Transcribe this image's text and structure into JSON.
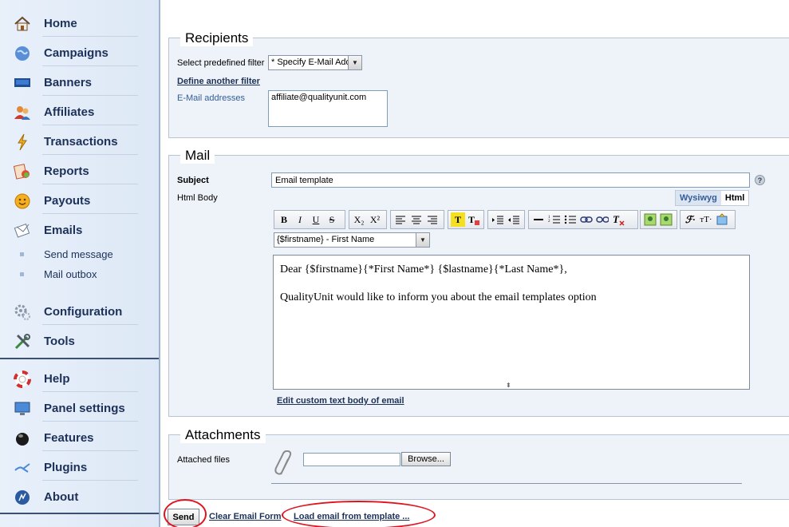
{
  "sidebar": {
    "items": [
      {
        "label": "Home",
        "icon": "home-icon"
      },
      {
        "label": "Campaigns",
        "icon": "globe-icon"
      },
      {
        "label": "Banners",
        "icon": "monitor-icon"
      },
      {
        "label": "Affiliates",
        "icon": "users-icon"
      },
      {
        "label": "Transactions",
        "icon": "lightning-icon"
      },
      {
        "label": "Reports",
        "icon": "report-icon"
      },
      {
        "label": "Payouts",
        "icon": "coin-icon"
      },
      {
        "label": "Emails",
        "icon": "envelope-icon"
      }
    ],
    "sub_items": [
      {
        "label": "Send message"
      },
      {
        "label": "Mail outbox"
      }
    ],
    "items2": [
      {
        "label": "Configuration",
        "icon": "gears-icon"
      },
      {
        "label": "Tools",
        "icon": "tools-icon"
      }
    ],
    "items3": [
      {
        "label": "Help",
        "icon": "lifebuoy-icon"
      },
      {
        "label": "Panel settings",
        "icon": "monitor-settings-icon"
      },
      {
        "label": "Features",
        "icon": "ball-icon"
      },
      {
        "label": "Plugins",
        "icon": "plug-icon"
      },
      {
        "label": "About",
        "icon": "about-icon"
      }
    ]
  },
  "recipients": {
    "legend": "Recipients",
    "filter_label": "Select predefined filter",
    "filter_value": "* Specify E-Mail Add",
    "define_filter_link": "Define another filter",
    "emails_label": "E-Mail addresses",
    "emails_value": "affiliate@qualityunit.com"
  },
  "mail": {
    "legend": "Mail",
    "subject_label": "Subject",
    "subject_value": "Email template",
    "help_icon": "?",
    "html_body_label": "Html Body",
    "tab_wysiwyg": "Wysiwyg",
    "tab_html": "Html",
    "variable_select": "{$firstname} - First Name",
    "body_line1": "Dear {$firstname}{*First Name*} {$lastname}{*Last Name*},",
    "body_line2": "QualityUnit would like to inform you about the email templates option",
    "edit_custom_link": "Edit custom text body of email",
    "toolbar": {
      "bold": "B",
      "italic": "I",
      "underline": "U",
      "strike": "S",
      "subscript": "X₂",
      "superscript": "X²"
    }
  },
  "attachments": {
    "legend": "Attachments",
    "label": "Attached files",
    "browse": "Browse..."
  },
  "footer": {
    "send": "Send",
    "clear": "Clear Email Form",
    "load_template": "Load email from template ..."
  },
  "colors": {
    "highlight": "#e0141e",
    "sidebar_text": "#1d3158",
    "panel_bg": "#eef3f9"
  }
}
